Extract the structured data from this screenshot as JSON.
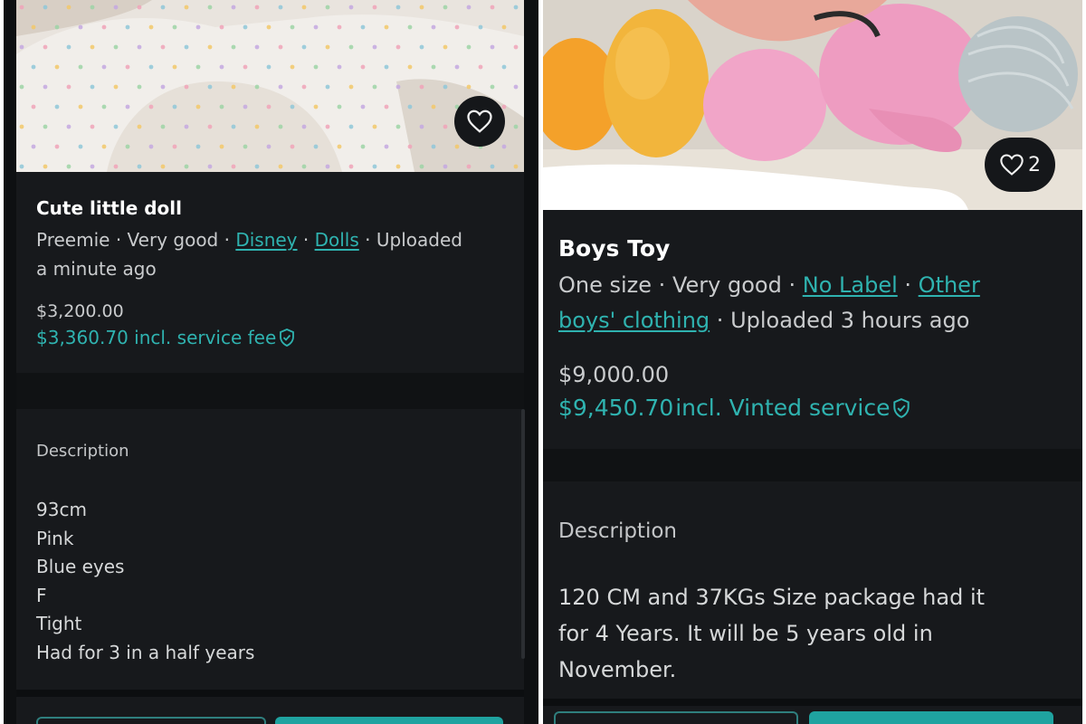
{
  "left": {
    "title": "Cute little doll",
    "meta": {
      "size": "Preemie",
      "condition": "Very good",
      "brand": "Disney",
      "category": "Dolls",
      "uploaded_line1": "Uploaded",
      "uploaded_line2": "a minute ago",
      "sep": "·"
    },
    "price": "$3,200.00",
    "price_fee": "$3,360.70 incl. service fee",
    "description_label": "Description",
    "description_lines": [
      "93cm",
      "Pink",
      "Blue eyes",
      "F",
      "Tight",
      "Had for 3 in a half years"
    ],
    "favourites": ""
  },
  "right": {
    "title": "Boys Toy",
    "meta": {
      "size": "One size",
      "condition": "Very good",
      "brand": "No Label",
      "category_line1": "Other",
      "category_line2": "boys' clothing",
      "uploaded": "Uploaded 3 hours ago",
      "sep": "·"
    },
    "price": "$9,000.00",
    "price_fee_amount": "$9,450.70",
    "price_fee_text": "incl. Vinted service",
    "description_label": "Description",
    "description_lines": [
      "120 CM and 37KGs Size package had it",
      "for 4 Years. It will be 5 years old in",
      "November."
    ],
    "favourites": "2"
  },
  "icons": {
    "heart": "heart-icon",
    "shield": "shield-check-icon"
  },
  "colors": {
    "background": "#0e1012",
    "card": "#17191c",
    "accent": "#2fb3b0"
  }
}
